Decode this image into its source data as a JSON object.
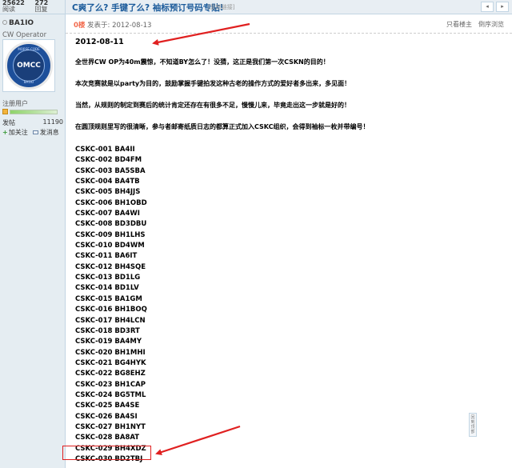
{
  "left": {
    "stats": [
      {
        "num": "25622",
        "label": "阅读"
      },
      {
        "num": "272",
        "label": "回复"
      }
    ],
    "username": "BA1IO",
    "role": "CW Operator",
    "avatar": {
      "center_text": "OMCC",
      "ring_top": "MORSE CODE",
      "ring_bottom": "BA1IO"
    },
    "group": "注册用户",
    "posts_label": "发帖",
    "posts_value": "11190",
    "follow": "加关注",
    "message": "发消息"
  },
  "header": {
    "title": "C爽了么? 手键了么? 袖标预订号码专贴!",
    "copy_link": "[复制链接]",
    "prev_icon": "◂",
    "next_icon": "▸"
  },
  "meta": {
    "floor": "0楼",
    "posted": "发表于: 2012-08-13",
    "only_author": "只看楼主",
    "reverse": "倒序浏览"
  },
  "content": {
    "date": "2012-08-11",
    "paragraphs": [
      "全世界CW OP为40m震惊，不知道BY怎么了！没猜，这正是我们第一次CSKN的目的！",
      "本次竞赛就是以party为目的，鼓励掌握手键拍发这种古老的操作方式的爱好者多出来，多见面！",
      "当然，从规则的制定到赛后的统计肯定还存在有很多不足，慢慢儿来，毕竟走出这一步就是好的！",
      "在圆顶规则里写的很清晰，参与者邮寄纸质日志的都算正式加入CSKC组织，会得到袖标一枚并带编号！"
    ],
    "list": [
      "CSKC-001 BA4II",
      "CSKC-002 BD4FM",
      "CSKC-003 BA5SBA",
      "CSKC-004 BA4TB",
      "CSKC-005 BH4JJS",
      "CSKC-006 BH1OBD",
      "CSKC-007 BA4WI",
      "CSKC-008 BD3DBU",
      "CSKC-009 BH1LHS",
      "CSKC-010 BD4WM",
      "CSKC-011 BA6IT",
      "CSKC-012 BH4SQE",
      "CSKC-013 BD1LG",
      "CSKC-014 BD1LV",
      "CSKC-015 BA1GM",
      "CSKC-016 BH1BOQ",
      "CSKC-017 BH4LCN",
      "CSKC-018 BD3RT",
      "CSKC-019 BA4MY",
      "CSKC-020 BH1MHI",
      "CSKC-021 BG4HYK",
      "CSKC-022 BG8EHZ",
      "CSKC-023 BH1CAP",
      "CSKC-024 BG5TML",
      "CSKC-025 BA4SE",
      "CSKC-026 BA4SI",
      "CSKC-027 BH1NYT",
      "CSKC-028 BA8AT",
      "CSKC-029 BH4XDZ",
      "CSKC-030 BD2TBJ"
    ]
  },
  "side_widget": "回到顶部",
  "colors": {
    "highlight": "#e02020",
    "title": "#1a5a9a",
    "floor": "#f26c4f"
  }
}
